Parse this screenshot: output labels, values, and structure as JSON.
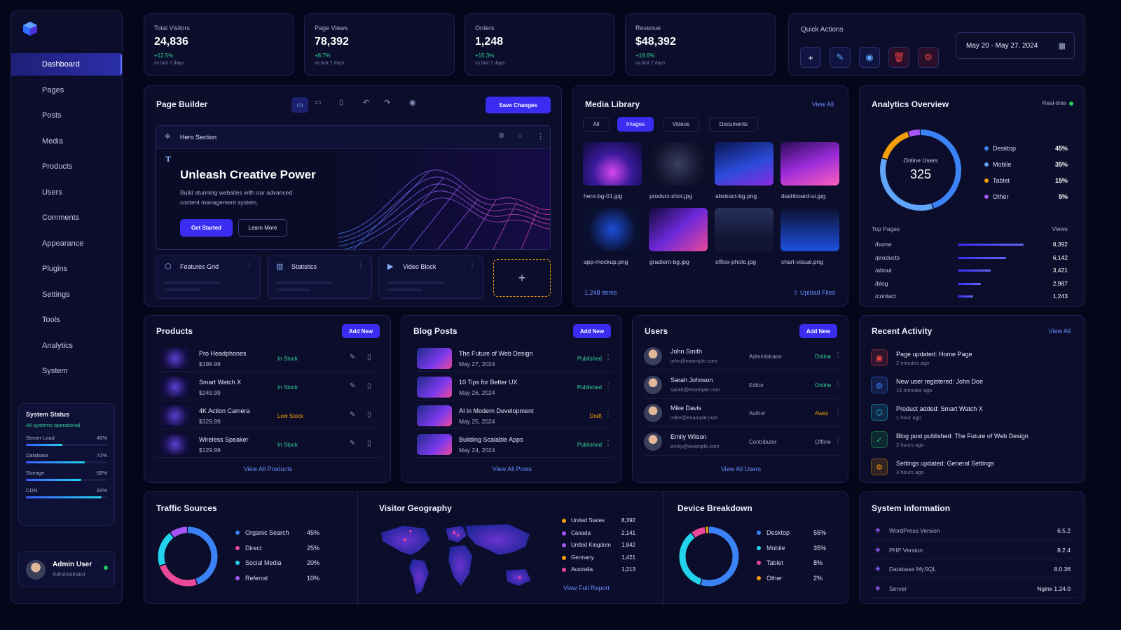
{
  "sidebar": {
    "items": [
      {
        "label": "Dashboard",
        "icon": "home-icon",
        "active": true
      },
      {
        "label": "Pages",
        "icon": "page-icon"
      },
      {
        "label": "Posts",
        "icon": "pen-icon"
      },
      {
        "label": "Media",
        "icon": "image-icon"
      },
      {
        "label": "Products",
        "icon": "cart-icon"
      },
      {
        "label": "Users",
        "icon": "user-icon"
      },
      {
        "label": "Comments",
        "icon": "comment-icon"
      },
      {
        "label": "Appearance",
        "icon": "brush-icon"
      },
      {
        "label": "Plugins",
        "icon": "plug-icon"
      },
      {
        "label": "Settings",
        "icon": "gear-icon"
      },
      {
        "label": "Tools",
        "icon": "wrench-icon"
      },
      {
        "label": "Analytics",
        "icon": "chart-icon"
      },
      {
        "label": "System",
        "icon": "cog-icon"
      }
    ],
    "system_status": {
      "title": "System Status",
      "subtitle": "All systems operational",
      "bars": [
        {
          "label": "Server Load",
          "value": "45%",
          "level": 45
        },
        {
          "label": "Database",
          "value": "72%",
          "level": 72
        },
        {
          "label": "Storage",
          "value": "68%",
          "level": 68
        },
        {
          "label": "CDN",
          "value": "93%",
          "level": 93
        }
      ]
    },
    "user": {
      "name": "Admin User",
      "role": "Administrator"
    }
  },
  "stats": [
    {
      "label": "Total Visitors",
      "value": "24,836",
      "change": "+12.5%",
      "sub": "vs last 7 days",
      "color": "#a855f7"
    },
    {
      "label": "Page Views",
      "value": "78,392",
      "change": "+8.7%",
      "sub": "vs last 7 days",
      "color": "#3b82f6"
    },
    {
      "label": "Orders",
      "value": "1,248",
      "change": "+15.3%",
      "sub": "vs last 7 days",
      "color": "#f59e0b"
    },
    {
      "label": "Revenue",
      "value": "$48,392",
      "change": "+18.6%",
      "sub": "vs last 7 days",
      "color": "#14b8a6"
    }
  ],
  "quick_actions": {
    "title": "Quick Actions",
    "date_range": "May 20 - May 27, 2024"
  },
  "page_builder": {
    "title": "Page Builder",
    "save_label": "Save Changes",
    "hero": {
      "section_label": "Hero Section",
      "heading": "Unleash Creative Power",
      "text": "Build stunning websites with our advanced content management system.",
      "primary": "Get Started",
      "secondary": "Learn More"
    },
    "blocks": [
      "Features Grid",
      "Statistics",
      "Video Block"
    ]
  },
  "media": {
    "title": "Media Library",
    "view_all": "View All",
    "tabs": [
      "All",
      "Images",
      "Videos",
      "Documents"
    ],
    "files": [
      "hero-bg-01.jpg",
      "product-shot.jpg",
      "abstract-bg.png",
      "dashboard-ui.jpg",
      "app-mockup.png",
      "gradient-bg.jpg",
      "office-photo.jpg",
      "chart-visual.png"
    ],
    "count": "1,248 items",
    "upload": "Upload Files"
  },
  "analytics": {
    "title": "Analytics Overview",
    "realtime": "Real-time",
    "online_label": "Online Users",
    "online_value": "325",
    "devices": [
      {
        "label": "Desktop",
        "value": "45%",
        "color": "#3b82f6"
      },
      {
        "label": "Mobile",
        "value": "35%",
        "color": "#60a5fa"
      },
      {
        "label": "Tablet",
        "value": "15%",
        "color": "#f59e0b"
      },
      {
        "label": "Other",
        "value": "5%",
        "color": "#a855f7"
      }
    ],
    "top_pages_label": "Top Pages",
    "views_label": "Views",
    "pages": [
      {
        "path": "/home",
        "views": "8,392",
        "share": 1.0
      },
      {
        "path": "/products",
        "views": "6,142",
        "share": 0.73
      },
      {
        "path": "/about",
        "views": "3,421",
        "share": 0.5
      },
      {
        "path": "/blog",
        "views": "2,987",
        "share": 0.35
      },
      {
        "path": "/contact",
        "views": "1,243",
        "share": 0.23
      }
    ]
  },
  "products": {
    "title": "Products",
    "add": "Add New",
    "view_all": "View All Products",
    "items": [
      {
        "name": "Pro Headphones",
        "price": "$199.99",
        "stock": "In Stock"
      },
      {
        "name": "Smart Watch X",
        "price": "$249.99",
        "stock": "In Stock"
      },
      {
        "name": "4K Action Camera",
        "price": "$329.99",
        "stock": "Low Stock"
      },
      {
        "name": "Wireless Speaker",
        "price": "$129.99",
        "stock": "In Stock"
      }
    ]
  },
  "blog": {
    "title": "Blog Posts",
    "add": "Add New",
    "view_all": "View All Posts",
    "items": [
      {
        "title": "The Future of Web Design",
        "date": "May 27, 2024",
        "status": "Published"
      },
      {
        "title": "10 Tips for Better UX",
        "date": "May 26, 2024",
        "status": "Published"
      },
      {
        "title": "AI in Modern Development",
        "date": "May 25, 2024",
        "status": "Draft"
      },
      {
        "title": "Building Scalable Apps",
        "date": "May 24, 2024",
        "status": "Published"
      }
    ]
  },
  "users": {
    "title": "Users",
    "add": "Add New",
    "view_all": "View All Users",
    "items": [
      {
        "name": "John Smith",
        "email": "john@example.com",
        "role": "Administrator",
        "status": "Online"
      },
      {
        "name": "Sarah Johnson",
        "email": "sarah@example.com",
        "role": "Editor",
        "status": "Online"
      },
      {
        "name": "Mike Davis",
        "email": "mike@example.com",
        "role": "Author",
        "status": "Away"
      },
      {
        "name": "Emily Wilson",
        "email": "emily@example.com",
        "role": "Contributor",
        "status": "Offline"
      }
    ]
  },
  "activity": {
    "title": "Recent Activity",
    "view_all": "View All",
    "items": [
      {
        "text": "Page updated: Home Page",
        "time": "2 minutes ago",
        "color": "#ef4444"
      },
      {
        "text": "New user registered: John Doe",
        "time": "15 minutes ago",
        "color": "#3b82f6"
      },
      {
        "text": "Product added: Smart Watch X",
        "time": "1 hour ago",
        "color": "#22d3ee"
      },
      {
        "text": "Blog post published: The Future of Web Design",
        "time": "2 hours ago",
        "color": "#22c55e"
      },
      {
        "text": "Settings updated: General Settings",
        "time": "3 hours ago",
        "color": "#f59e0b"
      }
    ]
  },
  "traffic": {
    "title": "Traffic Sources",
    "items": [
      {
        "label": "Organic Search",
        "value": "45%",
        "color": "#3b82f6"
      },
      {
        "label": "Direct",
        "value": "25%",
        "color": "#ec4899"
      },
      {
        "label": "Social Media",
        "value": "20%",
        "color": "#22d3ee"
      },
      {
        "label": "Referral",
        "value": "10%",
        "color": "#a855f7"
      }
    ]
  },
  "geo": {
    "title": "Visitor Geography",
    "countries": [
      {
        "label": "United States",
        "value": "8,392",
        "color": "#f59e0b"
      },
      {
        "label": "Canada",
        "value": "2,141",
        "color": "#a855f7"
      },
      {
        "label": "United Kingdom",
        "value": "1,842",
        "color": "#a855f7"
      },
      {
        "label": "Germany",
        "value": "1,421",
        "color": "#f59e0b"
      },
      {
        "label": "Australia",
        "value": "1,213",
        "color": "#ec4899"
      }
    ],
    "report": "View Full Report"
  },
  "devices": {
    "title": "Device Breakdown",
    "items": [
      {
        "label": "Desktop",
        "value": "55%",
        "color": "#3b82f6"
      },
      {
        "label": "Mobile",
        "value": "35%",
        "color": "#22d3ee"
      },
      {
        "label": "Tablet",
        "value": "8%",
        "color": "#ec4899"
      },
      {
        "label": "Other",
        "value": "2%",
        "color": "#f59e0b"
      }
    ]
  },
  "sysinfo": {
    "title": "System Information",
    "items": [
      {
        "label": "WordPress Version",
        "value": "6.5.2"
      },
      {
        "label": "PHP Version",
        "value": "8.2.4"
      },
      {
        "label": "Database MySQL",
        "value": "8.0.36"
      },
      {
        "label": "Server",
        "value": "Nginx 1.24.0"
      }
    ]
  }
}
